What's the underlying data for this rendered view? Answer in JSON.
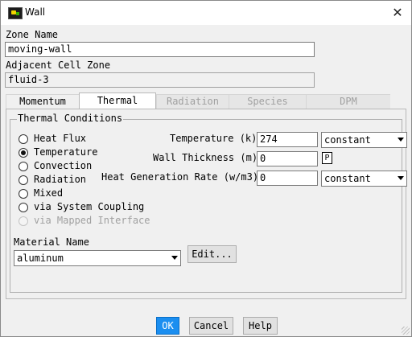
{
  "window": {
    "title": "Wall",
    "icon": "fluent-app-icon",
    "close_glyph": "✕"
  },
  "zone_name": {
    "label": "Zone Name",
    "value": "moving-wall"
  },
  "adjacent_cell_zone": {
    "label": "Adjacent Cell Zone",
    "value": "fluid-3"
  },
  "tabs": [
    {
      "label": "Momentum",
      "state": "normal"
    },
    {
      "label": "Thermal",
      "state": "active"
    },
    {
      "label": "Radiation",
      "state": "disabled"
    },
    {
      "label": "Species",
      "state": "disabled"
    },
    {
      "label": "DPM",
      "state": "disabled"
    }
  ],
  "thermal": {
    "group_title": "Thermal Conditions",
    "options": [
      {
        "label": "Heat Flux",
        "checked": false,
        "enabled": true
      },
      {
        "label": "Temperature",
        "checked": true,
        "enabled": true
      },
      {
        "label": "Convection",
        "checked": false,
        "enabled": true
      },
      {
        "label": "Radiation",
        "checked": false,
        "enabled": true
      },
      {
        "label": "Mixed",
        "checked": false,
        "enabled": true
      },
      {
        "label": "via System Coupling",
        "checked": false,
        "enabled": true
      },
      {
        "label": "via Mapped Interface",
        "checked": false,
        "enabled": false
      }
    ],
    "temperature": {
      "label": "Temperature (k)",
      "value": "274",
      "method": "constant"
    },
    "wall_thickness": {
      "label": "Wall Thickness (m)",
      "value": "0",
      "param_button": "P"
    },
    "heat_generation": {
      "label": "Heat Generation Rate (w/m3)",
      "value": "0",
      "method": "constant"
    }
  },
  "material": {
    "label": "Material Name",
    "value": "aluminum",
    "edit_button": "Edit..."
  },
  "buttons": {
    "ok": "OK",
    "cancel": "Cancel",
    "help": "Help"
  }
}
